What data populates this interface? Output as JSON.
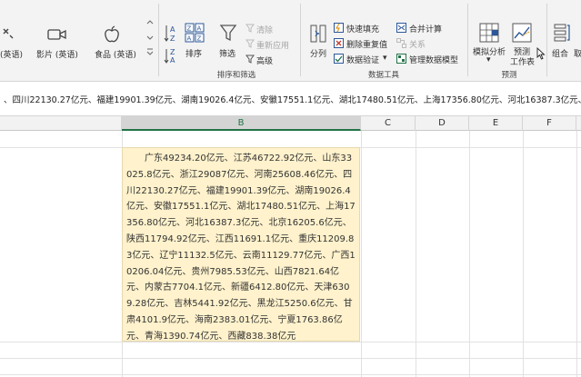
{
  "ribbon": {
    "data_types": {
      "first_label": "(英语)",
      "movie_label": "影片 (英语)",
      "food_label": "食品 (英语)"
    },
    "sort_filter": {
      "sort_label": "排序",
      "filter_label": "筛选",
      "clear_label": "清除",
      "reapply_label": "重新应用",
      "advanced_label": "高级",
      "group_label": "排序和筛选"
    },
    "data_tools": {
      "split_label": "分列",
      "flash_fill_label": "快速填充",
      "remove_duplicates_label": "删除重复值",
      "validation_label": "数据验证",
      "validation_arrow": "▾",
      "consolidate_label": "合并计算",
      "relationships_label": "关系",
      "manage_model_label": "管理数据模型",
      "group_label": "数据工具"
    },
    "forecast": {
      "whatif_label": "模拟分析",
      "whatif_arrow": "▾",
      "forecast_sheet_line1": "预测",
      "forecast_sheet_line2": "工作表",
      "group_label": "预测"
    },
    "outline": {
      "group_label_partial": "组合",
      "ungroup_partial": "取"
    }
  },
  "formula_bar": {
    "text": "、四川22130.27亿元、福建19901.39亿元、湖南19026.4亿元、安徽17551.1亿元、湖北17480.51亿元、上海17356.80亿元、河北16387.3亿元、北"
  },
  "sheet": {
    "columns": [
      "B",
      "C",
      "D",
      "E",
      "F"
    ],
    "cell_b_text": "广东49234.20亿元、江苏46722.92亿元、山东33025.8亿元、浙江29087亿元、河南25608.46亿元、四川22130.27亿元、福建19901.39亿元、湖南19026.4亿元、安徽17551.1亿元、湖北17480.51亿元、上海17356.80亿元、河北16387.3亿元、北京16205.6亿元、陕西11794.92亿元、江西11691.1亿元、重庆11209.83亿元、辽宁11132.5亿元、云南11129.77亿元、广西10206.04亿元、贵州7985.53亿元、山西7821.64亿元、内蒙古7704.1亿元、新疆6412.80亿元、天津6309.28亿元、吉林5441.92亿元、黑龙江5250.6亿元、甘肃4101.9亿元、海南2383.01亿元、宁夏1763.86亿元、青海1390.74亿元、西藏838.38亿元"
  },
  "colors": {
    "accent_green": "#217346",
    "cell_fill": "#fff2cc",
    "icon_blue": "#2b579a"
  }
}
